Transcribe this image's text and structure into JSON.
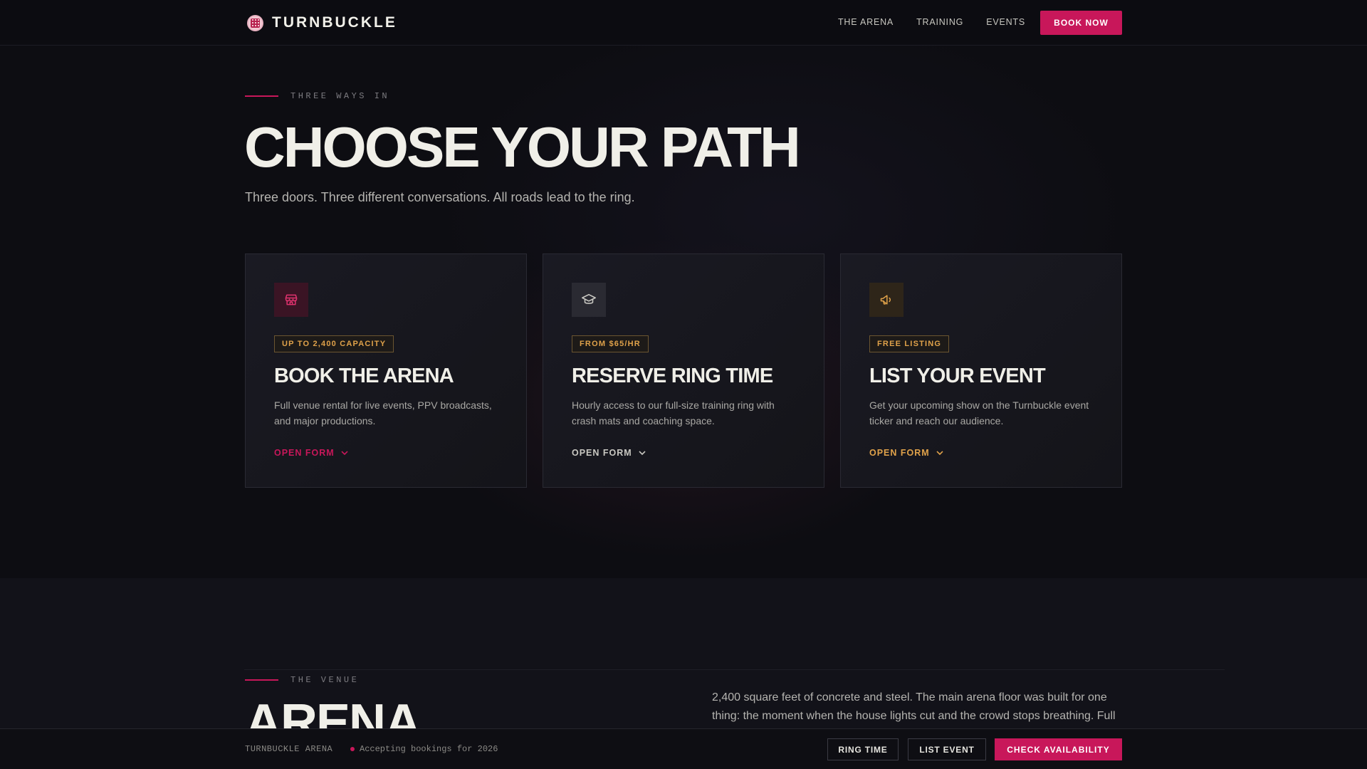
{
  "header": {
    "brand": "TURNBUCKLE",
    "nav": [
      "THE ARENA",
      "TRAINING",
      "EVENTS"
    ],
    "cta": "BOOK NOW"
  },
  "paths": {
    "eyebrow": "THREE WAYS IN",
    "title": "CHOOSE YOUR PATH",
    "subtitle": "Three doors. Three different conversations. All roads lead to the ring.",
    "cards": [
      {
        "icon": "storefront-icon",
        "badge": "UP TO 2,400 CAPACITY",
        "title": "BOOK THE ARENA",
        "description": "Full venue rental for live events, PPV broadcasts, and major productions.",
        "action": "OPEN FORM",
        "accent": "#c8175a"
      },
      {
        "icon": "graduation-cap-icon",
        "badge": "FROM $65/HR",
        "title": "RESERVE RING TIME",
        "description": "Hourly access to our full-size training ring with crash mats and coaching space.",
        "action": "OPEN FORM",
        "accent": "#c9c8c2"
      },
      {
        "icon": "megaphone-icon",
        "badge": "FREE LISTING",
        "title": "LIST YOUR EVENT",
        "description": "Get your upcoming show on the Turnbuckle event ticker and reach our audience.",
        "action": "OPEN FORM",
        "accent": "#e0a24a"
      }
    ]
  },
  "venue": {
    "eyebrow": "THE VENUE",
    "title": "ARENA",
    "description": "2,400 square feet of concrete and steel. The main arena floor was built for one thing: the moment when the house lights cut and the crowd stops breathing. Full"
  },
  "bottombar": {
    "brand": "TURNBUCKLE ARENA",
    "status": "Accepting bookings for 2026",
    "buttons": [
      "RING TIME",
      "LIST EVENT"
    ],
    "primary": "CHECK AVAILABILITY"
  },
  "colors": {
    "accent": "#c8175a",
    "gold": "#e0a24a",
    "background": "#0d0d12"
  }
}
